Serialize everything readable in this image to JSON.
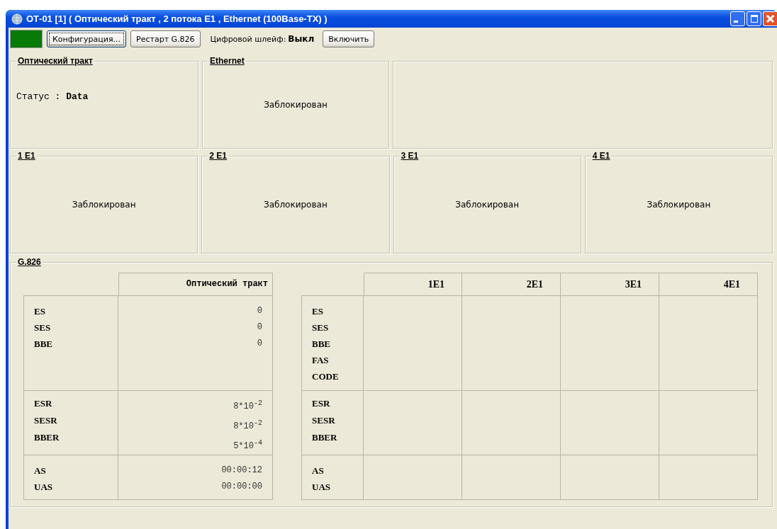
{
  "window": {
    "title": "ОТ-01 [1] ( Оптический тракт , 2 потока E1 , Ethernet (100Base-TX) )"
  },
  "toolbar": {
    "buttons": [
      {
        "label": "Конфигурация...",
        "focused": true
      },
      {
        "label": "Рестарт G.826",
        "focused": false
      }
    ],
    "loop_label": "Цифровой шлейф:",
    "loop_value": "Выкл",
    "loop_button": {
      "label": "Включить",
      "focused": false
    }
  },
  "top_panels": [
    {
      "title": "Оптический тракт",
      "status": "Статус : **Data**",
      "kind": "status"
    },
    {
      "title": "Ethernet",
      "text": "Заблокирован",
      "kind": "text"
    },
    {
      "kind": "empty"
    }
  ],
  "e1_panels": [
    {
      "title": "1 E1",
      "text": "Заблокирован"
    },
    {
      "title": "2 E1",
      "text": "Заблокирован"
    },
    {
      "title": "3 E1",
      "text": "Заблокирован"
    },
    {
      "title": "4 E1",
      "text": "Заблокирован"
    }
  ],
  "g826": {
    "title": "G.826",
    "optical_table": {
      "header": "Оптический тракт",
      "sections": [
        {
          "rows": [
            {
              "label": "ES",
              "value": "0"
            },
            {
              "label": "SES",
              "value": "0"
            },
            {
              "label": "BBE",
              "value": "0"
            }
          ]
        },
        {
          "rows": [
            {
              "label": "ESR",
              "value": "8*10$^{-2}$"
            },
            {
              "label": "SESR",
              "value": "8*10$^{-2}$"
            },
            {
              "label": "BBER",
              "value": "5*10$^{-4}$"
            }
          ]
        },
        {
          "rows": [
            {
              "label": "AS",
              "value": "00:00:12"
            },
            {
              "label": "UAS",
              "value": "00:00:00"
            }
          ]
        }
      ]
    },
    "e1_table": {
      "columns": [
        "1E1",
        "2E1",
        "3E1",
        "4E1"
      ],
      "sections": [
        {
          "labels": [
            "ES",
            "SES",
            "BBE",
            "FAS",
            "CODE"
          ]
        },
        {
          "labels": [
            "ESR",
            "SESR",
            "BBER"
          ]
        },
        {
          "labels": [
            "AS",
            "UAS"
          ]
        }
      ]
    }
  }
}
